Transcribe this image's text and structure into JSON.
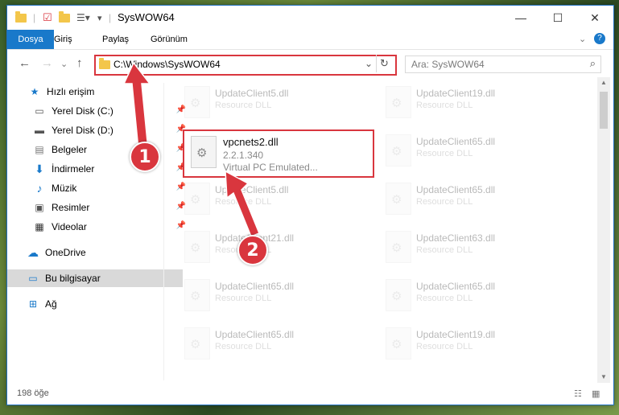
{
  "window": {
    "title": "SysWOW64"
  },
  "ribbon": {
    "tabs": [
      "Dosya",
      "Giriş",
      "Paylaş",
      "Görünüm"
    ]
  },
  "address": {
    "path": "C:\\Windows\\SysWOW64"
  },
  "search": {
    "placeholder": "Ara: SysWOW64"
  },
  "sidebar": {
    "quick_access": "Hızlı erişim",
    "items": [
      "Yerel Disk (C:)",
      "Yerel Disk (D:)",
      "Belgeler",
      "İndirmeler",
      "Müzik",
      "Resimler",
      "Videolar"
    ],
    "onedrive": "OneDrive",
    "this_pc": "Bu bilgisayar",
    "network": "Ağ"
  },
  "files_left": [
    {
      "name": "UpdateClient5.dll",
      "desc": "Resource DLL"
    },
    {
      "name": "UpdateClient5.dll",
      "desc": "Resource DLL"
    },
    {
      "name": "UpdateClient21.dll",
      "desc": "Resource DLL"
    },
    {
      "name": "UpdateClient65.dll",
      "desc": "Resource DLL"
    },
    {
      "name": "UpdateClient65.dll",
      "desc": "Resource DLL"
    }
  ],
  "files_right": [
    {
      "name": "UpdateClient19.dll",
      "desc": "Resource DLL"
    },
    {
      "name": "UpdateClient65.dll",
      "desc": "Resource DLL"
    },
    {
      "name": "UpdateClient65.dll",
      "desc": "Resource DLL"
    },
    {
      "name": "UpdateClient63.dll",
      "desc": "Resource DLL"
    },
    {
      "name": "UpdateClient65.dll",
      "desc": "Resource DLL"
    },
    {
      "name": "UpdateClient19.dll",
      "desc": "Resource DLL"
    }
  ],
  "highlighted_file": {
    "name": "vpcnets2.dll",
    "version": "2.2.1.340",
    "desc": "Virtual PC Emulated..."
  },
  "status": {
    "count": "198 öğe"
  },
  "annotations": {
    "badge1": "1",
    "badge2": "2"
  },
  "colors": {
    "accent": "#1979ca",
    "highlight": "#d9363e"
  }
}
